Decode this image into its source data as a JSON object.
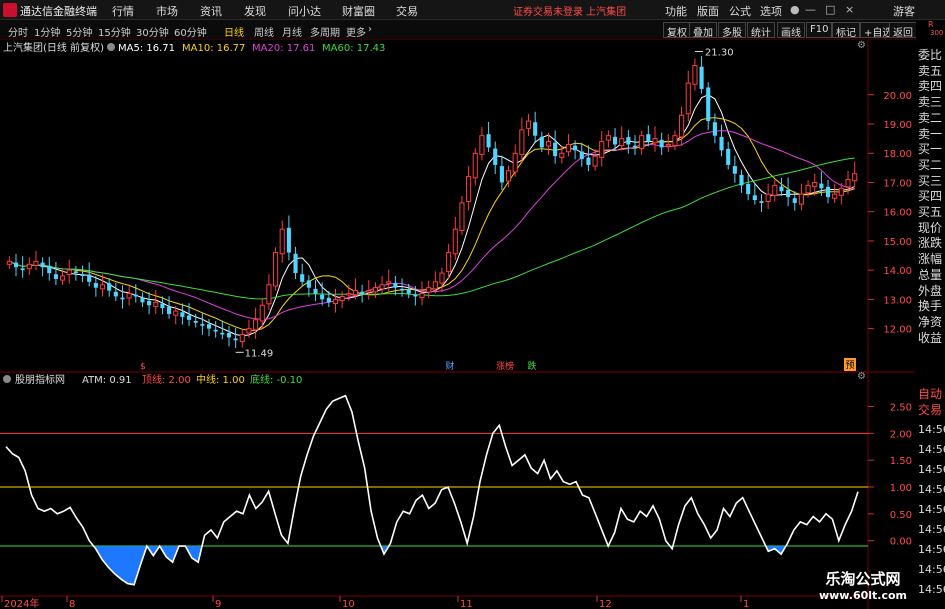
{
  "window": {
    "app_title": "通达信金融终端",
    "menu": [
      "行情",
      "市场",
      "资讯",
      "发现",
      "问小达",
      "财富圈",
      "交易"
    ],
    "notice": "证券交易未登录 上汽集团",
    "right_menu": [
      "功能",
      "版面",
      "公式",
      "选项"
    ],
    "guest_label": "游客"
  },
  "toolbar": {
    "periods": [
      "分时",
      "1分钟",
      "5分钟",
      "15分钟",
      "30分钟",
      "60分钟",
      "日线",
      "周线",
      "月线",
      "多周期",
      "更多"
    ],
    "active_period": "日线",
    "buttons": [
      "复权",
      "叠加",
      "多股",
      "统计",
      "画线",
      "F10",
      "标记",
      "+自选",
      "返回"
    ],
    "corner_label": "R",
    "corner_number": "300"
  },
  "price_panel": {
    "header": "上汽集团(日线 前复权)",
    "ma_legends": [
      {
        "label": "MA5: 16.71",
        "color": "#ffffff"
      },
      {
        "label": "MA10: 16.77",
        "color": "#ffd400"
      },
      {
        "label": "MA20: 17.61",
        "color": "#e040e0"
      },
      {
        "label": "MA60: 17.43",
        "color": "#3ddc3d"
      }
    ],
    "high_label": "21.30",
    "low_label": "11.49",
    "event_marks": [
      {
        "label": "财",
        "color": "#5aa0ff"
      },
      {
        "label": "涨榜",
        "color": "#ff4b4b"
      },
      {
        "label": "跌",
        "color": "#3ddc3d"
      },
      {
        "label": "预",
        "color": "#ff9a2a"
      }
    ]
  },
  "indicator_panel": {
    "header": "股朋指标网",
    "legends": [
      {
        "label": "ATM: 0.91",
        "color": "#dddddd"
      },
      {
        "label": "顶线: 2.00",
        "color": "#ff4b4b"
      },
      {
        "label": "中线: 1.00",
        "color": "#ffd400"
      },
      {
        "label": "底线: -0.10",
        "color": "#3ddc3d"
      }
    ]
  },
  "right_strip": {
    "top_items": [
      "委比",
      "卖五",
      "卖四",
      "卖三",
      "卖二",
      "卖一",
      "买一",
      "买二",
      "买三",
      "买四",
      "买五",
      "现价",
      "涨跌",
      "涨幅",
      "总量",
      "外盘",
      "换手",
      "净资",
      "收益"
    ],
    "auto_trade": [
      "自动",
      "交易"
    ],
    "time_items": [
      "14:56",
      "14:56",
      "14:56",
      "14:56",
      "14:56",
      "14:56",
      "14:56",
      "14:56",
      "14:56"
    ]
  },
  "date_axis": [
    "2024年",
    "8",
    "9",
    "10",
    "11",
    "12",
    "1"
  ],
  "watermark": {
    "brand": "乐淘公式网",
    "url": "www.60lt.com"
  },
  "colors": {
    "up": "#ff3b3b",
    "down": "#4fd5ff",
    "ma5": "#ffffff",
    "ma10": "#ffd400",
    "ma20": "#e040e0",
    "ma60": "#3ddc3d",
    "border": "#7a0000"
  },
  "chart_data": [
    {
      "type": "candlestick",
      "y_axis_ticks": [
        20.0,
        19.0,
        18.0,
        17.0,
        16.0,
        15.0,
        14.0,
        13.0,
        12.0
      ],
      "ylim": [
        11.2,
        21.6
      ],
      "close": [
        14.3,
        14.1,
        14.0,
        14.2,
        14.3,
        14.1,
        13.9,
        13.7,
        13.8,
        14.0,
        13.9,
        13.8,
        13.6,
        13.4,
        13.5,
        13.3,
        13.1,
        13.0,
        13.2,
        13.1,
        12.9,
        12.8,
        12.9,
        12.7,
        12.5,
        12.6,
        12.4,
        12.3,
        12.2,
        12.1,
        12.0,
        11.9,
        11.8,
        11.7,
        11.6,
        11.8,
        12.0,
        12.3,
        12.8,
        13.5,
        14.6,
        15.4,
        14.6,
        13.9,
        13.6,
        13.4,
        13.2,
        13.0,
        12.9,
        13.0,
        13.1,
        13.2,
        13.3,
        13.2,
        13.3,
        13.4,
        13.5,
        13.6,
        13.4,
        13.3,
        13.2,
        13.1,
        13.2,
        13.4,
        13.6,
        13.9,
        14.6,
        15.4,
        16.3,
        17.2,
        18.0,
        18.6,
        18.2,
        17.6,
        17.0,
        17.4,
        18.0,
        18.8,
        19.1,
        18.6,
        18.2,
        18.4,
        17.9,
        18.0,
        18.3,
        18.1,
        17.8,
        17.6,
        17.9,
        18.4,
        18.6,
        18.3,
        18.5,
        18.3,
        18.2,
        18.6,
        18.4,
        18.5,
        18.2,
        18.3,
        18.6,
        19.3,
        20.4,
        21.0,
        20.2,
        19.1,
        18.6,
        18.1,
        17.6,
        17.3,
        16.9,
        16.6,
        16.4,
        16.3,
        16.6,
        16.9,
        16.7,
        16.5,
        16.3,
        16.6,
        16.9,
        17.0,
        16.8,
        16.5,
        16.6,
        16.8,
        17.1,
        17.3
      ],
      "annotations": [
        "21.30",
        "11.49"
      ],
      "series": [
        {
          "name": "MA5",
          "last": 16.71
        },
        {
          "name": "MA10",
          "last": 16.77
        },
        {
          "name": "MA20",
          "last": 17.61
        },
        {
          "name": "MA60",
          "last": 17.43
        }
      ]
    },
    {
      "type": "line",
      "y_axis_ticks": [
        2.5,
        2.0,
        1.5,
        1.0,
        0.5,
        0.0
      ],
      "ylim": [
        -0.9,
        2.9
      ],
      "reference_lines": [
        2.0,
        1.0,
        -0.1
      ],
      "series": [
        {
          "name": "ATM",
          "values": [
            1.75,
            1.62,
            1.55,
            1.3,
            0.85,
            0.6,
            0.55,
            0.6,
            0.5,
            0.55,
            0.62,
            0.42,
            0.25,
            0.0,
            -0.15,
            -0.35,
            -0.5,
            -0.62,
            -0.72,
            -0.8,
            -0.82,
            -0.45,
            -0.1,
            -0.28,
            -0.1,
            -0.3,
            -0.4,
            -0.1,
            -0.1,
            -0.32,
            -0.4,
            0.1,
            0.2,
            0.05,
            0.35,
            0.45,
            0.55,
            0.5,
            0.85,
            0.6,
            0.72,
            0.92,
            0.5,
            0.1,
            -0.05,
            0.6,
            1.2,
            1.6,
            1.95,
            2.2,
            2.45,
            2.6,
            2.65,
            2.7,
            2.4,
            1.85,
            1.35,
            0.55,
            0.05,
            -0.25,
            -0.05,
            0.35,
            0.55,
            0.5,
            0.75,
            0.85,
            0.6,
            0.7,
            0.95,
            1.0,
            0.7,
            0.35,
            -0.05,
            0.45,
            1.1,
            1.6,
            2.0,
            2.15,
            1.75,
            1.4,
            1.5,
            1.6,
            1.35,
            1.25,
            1.5,
            1.15,
            1.3,
            1.1,
            1.05,
            1.1,
            0.85,
            0.8,
            0.5,
            0.2,
            -0.1,
            0.15,
            0.6,
            0.4,
            0.35,
            0.55,
            0.45,
            0.65,
            0.4,
            0.0,
            -0.15,
            0.3,
            0.65,
            0.8,
            0.5,
            0.3,
            0.05,
            0.2,
            0.6,
            0.45,
            0.7,
            0.8,
            0.55,
            0.3,
            0.05,
            -0.2,
            -0.15,
            -0.25,
            -0.05,
            0.2,
            0.35,
            0.3,
            0.45,
            0.35,
            0.5,
            0.4,
            0.0,
            0.3,
            0.55,
            0.91
          ]
        }
      ]
    }
  ]
}
